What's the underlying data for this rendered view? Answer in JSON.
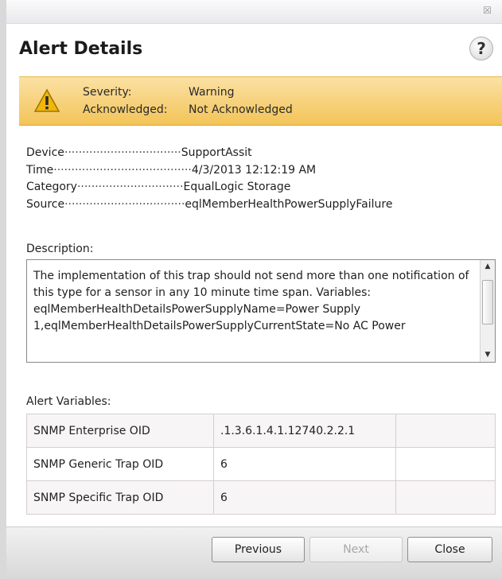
{
  "window": {
    "close_glyph": "☒"
  },
  "header": {
    "title": "Alert Details",
    "help_glyph": "?"
  },
  "banner": {
    "icon": "warning-triangle-icon",
    "colors": {
      "background": "#f3c458",
      "icon": "#f2b705"
    },
    "severity_label": "Severity:",
    "severity_value": "Warning",
    "ack_label": "Acknowledged:",
    "ack_value": "Not Acknowledged"
  },
  "details": [
    {
      "label": "Device",
      "dots": "·································",
      "value": "SupportAssit"
    },
    {
      "label": "Time",
      "dots": "·······································",
      "value": "4/3/2013 12:12:19 AM"
    },
    {
      "label": "Category",
      "dots": "······························",
      "value": "EqualLogic Storage"
    },
    {
      "label": "Source",
      "dots": "··································",
      "value": "eqlMemberHealthPowerSupplyFailure"
    }
  ],
  "description": {
    "label": "Description:",
    "text": "The implementation of this trap should not send more than one notification of this type for a sensor in any 10 minute time span. Variables: eqlMemberHealthDetailsPowerSupplyName=Power Supply 1,eqlMemberHealthDetailsPowerSupplyCurrentState=No AC Power",
    "scroll_up_glyph": "▲",
    "scroll_down_glyph": "▼"
  },
  "alert_variables": {
    "label": "Alert Variables:",
    "rows": [
      {
        "name": "SNMP Enterprise OID",
        "value": ".1.3.6.1.4.1.12740.2.2.1",
        "extra": ""
      },
      {
        "name": "SNMP Generic Trap OID",
        "value": "6",
        "extra": ""
      },
      {
        "name": "SNMP Specific Trap OID",
        "value": "6",
        "extra": ""
      }
    ]
  },
  "footer": {
    "previous": "Previous",
    "next": "Next",
    "close": "Close"
  }
}
